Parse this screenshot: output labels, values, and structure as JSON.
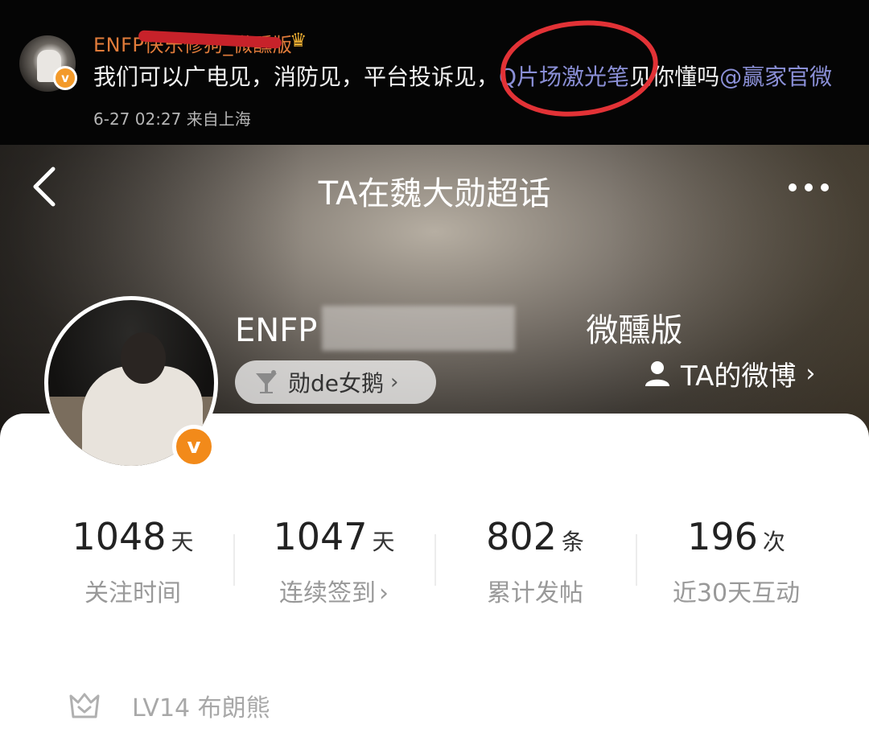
{
  "post": {
    "author": "ENFP快乐修狗_微醺版",
    "text_main": "我们可以广电见，消防见，平台投诉见，",
    "text_link": "Q片场激光笔",
    "text_after": "见你懂吗",
    "mention": "@赢家官微",
    "time": "6-27 02:27",
    "source": "来自上海"
  },
  "header": {
    "title": "TA在魏大勋超话",
    "back_icon": "chevron-left-icon",
    "more_icon": "more-dots-icon"
  },
  "profile": {
    "name_start": "ENFP",
    "name_end": "微醺版",
    "tag": "勋de女鹅",
    "weibo_link": "TA的微博"
  },
  "stats": [
    {
      "value": "1048",
      "unit": "天",
      "label": "关注时间",
      "link": false
    },
    {
      "value": "1047",
      "unit": "天",
      "label": "连续签到",
      "link": true
    },
    {
      "value": "802",
      "unit": "条",
      "label": "累计发帖",
      "link": false
    },
    {
      "value": "196",
      "unit": "次",
      "label": "近30天互动",
      "link": false
    }
  ],
  "level": {
    "text": "LV14 布朗熊"
  },
  "colors": {
    "accent": "#f28a1a",
    "link": "#8a8fd6",
    "mark": "#e23236"
  }
}
